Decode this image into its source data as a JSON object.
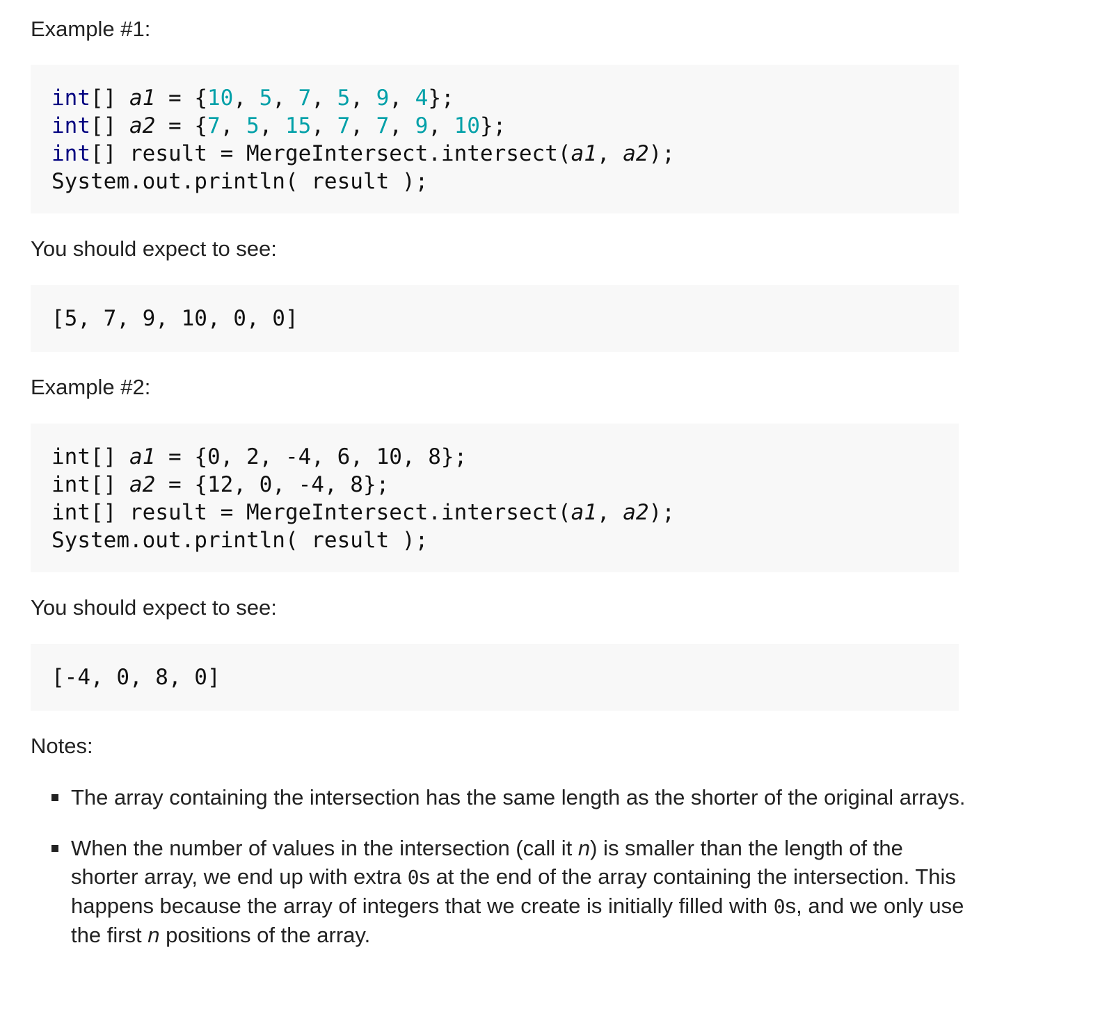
{
  "example1": {
    "heading": "Example #1:",
    "code": {
      "line1": {
        "kw": "int",
        "rest1": "[] ",
        "var": "a1",
        "rest2": " = {",
        "nums": [
          "10",
          "5",
          "7",
          "5",
          "9",
          "4"
        ],
        "end": "};"
      },
      "line2": {
        "kw": "int",
        "rest1": "[] ",
        "var": "a2",
        "rest2": " = {",
        "nums": [
          "7",
          "5",
          "15",
          "7",
          "7",
          "9",
          "10"
        ],
        "end": "};"
      },
      "line3": {
        "kw": "int",
        "rest": "[] result = MergeIntersect.intersect(",
        "arg1": "a1",
        "sep": ", ",
        "arg2": "a2",
        "end": ");"
      },
      "line4": "System.out.println( result );"
    },
    "expect_label": "You should expect to see:",
    "output": "[5, 7, 9, 10, 0, 0]"
  },
  "example2": {
    "heading": "Example #2:",
    "code": {
      "line1": {
        "kw": "int",
        "rest1": "[] ",
        "var": "a1",
        "rest2": " = {0, 2, -4, 6, 10, 8};"
      },
      "line2": {
        "kw": "int",
        "rest1": "[] ",
        "var": "a2",
        "rest2": " = {12, 0, -4, 8};"
      },
      "line3": {
        "kw": "int",
        "rest": "[] result = MergeIntersect.intersect(",
        "arg1": "a1",
        "sep": ", ",
        "arg2": "a2",
        "end": ");"
      },
      "line4": "System.out.println( result );"
    },
    "expect_label": "You should expect to see:",
    "output": "[-4, 0, 8, 0]"
  },
  "notes": {
    "heading": "Notes:",
    "items": [
      {
        "text": "The array containing the intersection has the same length as the shorter of the original arrays."
      },
      {
        "part1": "When the number of values in the intersection (call it ",
        "n1": "n",
        "part2": ") is smaller than the length of the shorter array, we end up with extra ",
        "zero1": "0",
        "part3": "s at the end of the array containing the intersection. This happens because the array of integers that we create is initially filled with ",
        "zero2": "0",
        "part4": "s, and we only use the first ",
        "n2": "n",
        "part5": " positions of the array."
      }
    ]
  },
  "colors": {
    "keyword": "#000080",
    "number": "#00a0a8",
    "code_bg": "#f8f8f8",
    "text": "#222222"
  }
}
